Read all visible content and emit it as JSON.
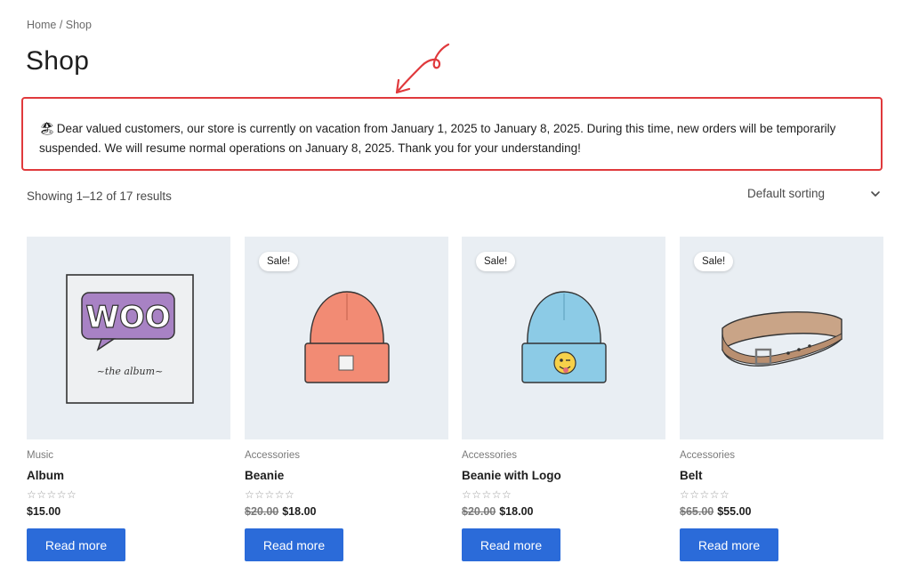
{
  "breadcrumb": "Home / Shop",
  "page_title": "Shop",
  "notice": {
    "emoji": "🏖",
    "text": "Dear valued customers, our store is currently on vacation from January 1, 2025 to January 8, 2025. During this time, new orders will be temporarily suspended. We will resume normal operations on January 8, 2025. Thank you for your understanding!",
    "border_color": "#e0393c"
  },
  "result_count": "Showing 1–12 of 17 results",
  "sorting": {
    "selected": "Default sorting"
  },
  "accent_color": "#2b6bd9",
  "products": [
    {
      "category": "Music",
      "name": "Album",
      "sale_badge": "",
      "old_price": "",
      "price": "$15.00",
      "button": "Read more",
      "stars": "☆☆☆☆☆",
      "image": "album-woo-icon"
    },
    {
      "category": "Accessories",
      "name": "Beanie",
      "sale_badge": "Sale!",
      "old_price": "$20.00",
      "price": "$18.00",
      "button": "Read more",
      "stars": "☆☆☆☆☆",
      "image": "orange-beanie-icon"
    },
    {
      "category": "Accessories",
      "name": "Beanie with Logo",
      "sale_badge": "Sale!",
      "old_price": "$20.00",
      "price": "$18.00",
      "button": "Read more",
      "stars": "☆☆☆☆☆",
      "image": "blue-beanie-icon"
    },
    {
      "category": "Accessories",
      "name": "Belt",
      "sale_badge": "Sale!",
      "old_price": "$65.00",
      "price": "$55.00",
      "button": "Read more",
      "stars": "☆☆☆☆☆",
      "image": "belt-icon"
    }
  ]
}
